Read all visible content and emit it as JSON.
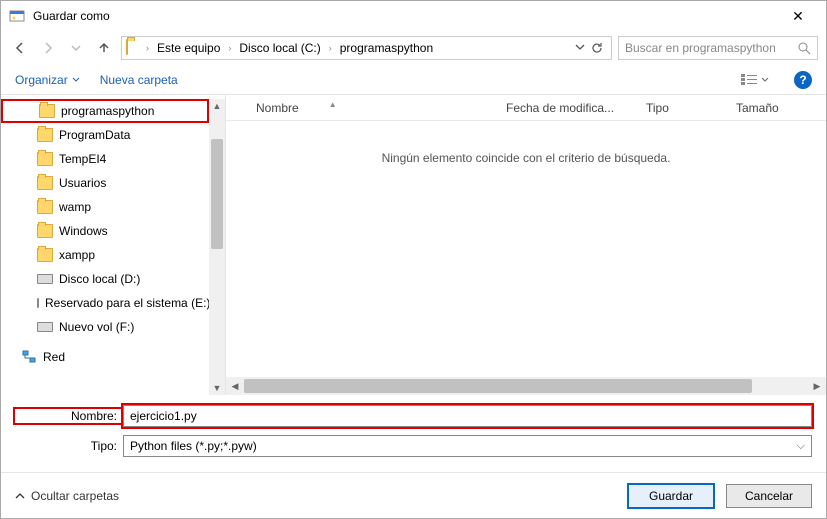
{
  "window": {
    "title": "Guardar como"
  },
  "nav": {
    "crumbs": [
      "Este equipo",
      "Disco local (C:)",
      "programaspython"
    ],
    "search_placeholder": "Buscar en programaspython"
  },
  "toolbar": {
    "organizar": "Organizar",
    "nueva_carpeta": "Nueva carpeta"
  },
  "tree": {
    "items": [
      {
        "label": "programaspython",
        "icon": "folder",
        "selected": true
      },
      {
        "label": "ProgramData",
        "icon": "folder"
      },
      {
        "label": "TempEI4",
        "icon": "folder"
      },
      {
        "label": "Usuarios",
        "icon": "folder"
      },
      {
        "label": "wamp",
        "icon": "folder"
      },
      {
        "label": "Windows",
        "icon": "folder"
      },
      {
        "label": "xampp",
        "icon": "folder"
      },
      {
        "label": "Disco local (D:)",
        "icon": "drive"
      },
      {
        "label": "Reservado para el sistema (E:)",
        "icon": "drive"
      },
      {
        "label": "Nuevo vol (F:)",
        "icon": "drive"
      }
    ],
    "network": "Red"
  },
  "columns": {
    "nombre": "Nombre",
    "fecha": "Fecha de modifica...",
    "tipo": "Tipo",
    "tamano": "Tamaño"
  },
  "empty_msg": "Ningún elemento coincide con el criterio de búsqueda.",
  "form": {
    "nombre_label": "Nombre:",
    "nombre_value": "ejercicio1.py",
    "tipo_label": "Tipo:",
    "tipo_value": "Python files (*.py;*.pyw)"
  },
  "footer": {
    "hide": "Ocultar carpetas",
    "guardar": "Guardar",
    "cancelar": "Cancelar"
  }
}
